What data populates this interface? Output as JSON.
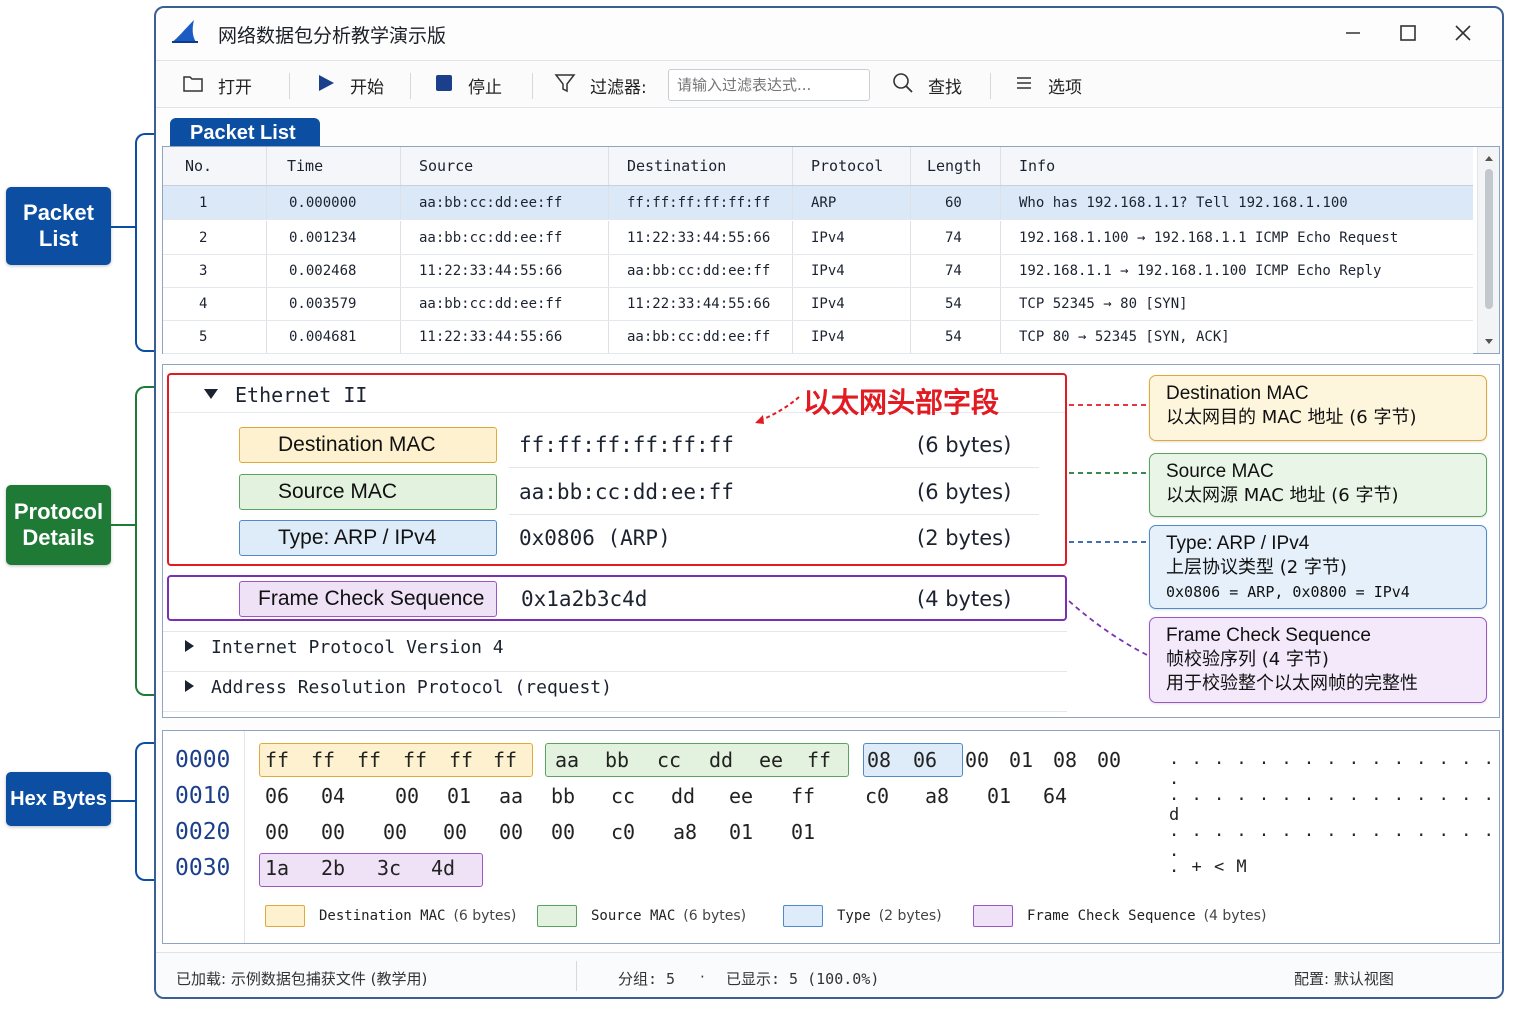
{
  "window": {
    "title": "网络数据包分析教学演示版"
  },
  "callouts": {
    "packet_list": "Packet List",
    "protocol_details": "Protocol Details",
    "hex_bytes": "Hex Bytes"
  },
  "toolbar": {
    "open": "打开",
    "start": "开始",
    "stop": "停止",
    "filter_label": "过滤器:",
    "filter_placeholder": "请输入过滤表达式...",
    "find": "查找",
    "options": "选项"
  },
  "packet_list": {
    "tab": "Packet List",
    "columns": [
      "No.",
      "Time",
      "Source",
      "Destination",
      "Protocol",
      "Length",
      "Info"
    ],
    "rows": [
      [
        "1",
        "0.000000",
        "aa:bb:cc:dd:ee:ff",
        "ff:ff:ff:ff:ff:ff",
        "ARP",
        "60",
        "Who has 192.168.1.1?  Tell  192.168.1.100"
      ],
      [
        "2",
        "0.001234",
        "aa:bb:cc:dd:ee:ff",
        "11:22:33:44:55:66",
        "IPv4",
        "74",
        "192.168.1.100  →  192.168.1.1  ICMP Echo Request"
      ],
      [
        "3",
        "0.002468",
        "11:22:33:44:55:66",
        "aa:bb:cc:dd:ee:ff",
        "IPv4",
        "74",
        "192.168.1.1  →  192.168.1.100  ICMP Echo Reply"
      ],
      [
        "4",
        "0.003579",
        "aa:bb:cc:dd:ee:ff",
        "11:22:33:44:55:66",
        "IPv4",
        "54",
        "TCP 52345  →  80  [SYN]"
      ],
      [
        "5",
        "0.004681",
        "11:22:33:44:55:66",
        "aa:bb:cc:dd:ee:ff",
        "IPv4",
        "54",
        "TCP 80  →  52345  [SYN, ACK]"
      ]
    ],
    "selected_row": 1
  },
  "details": {
    "ethernet_title": "Ethernet II",
    "annotation": "以太网头部字段",
    "fields": [
      {
        "name": "Destination MAC",
        "value": "ff:ff:ff:ff:ff:ff",
        "bytes": "(6 bytes)"
      },
      {
        "name": "Source MAC",
        "value": "aa:bb:cc:dd:ee:ff",
        "bytes": "(6 bytes)"
      },
      {
        "name": "Type: ARP / IPv4",
        "value": "0x0806  (ARP)",
        "bytes": "(2 bytes)"
      }
    ],
    "fcs": {
      "name": "Frame Check Sequence",
      "value": "0x1a2b3c4d",
      "bytes": "(4 bytes)"
    },
    "collapsed": [
      "Internet Protocol Version 4",
      "Address Resolution Protocol (request)"
    ]
  },
  "notes": [
    {
      "title": "Destination MAC",
      "lines": [
        "以太网目的 MAC 地址 (6 字节)"
      ]
    },
    {
      "title": "Source MAC",
      "lines": [
        "以太网源 MAC 地址 (6 字节)"
      ]
    },
    {
      "title": "Type: ARP / IPv4",
      "lines": [
        "上层协议类型 (2 字节)",
        "0x0806 = ARP, 0x0800 = IPv4"
      ]
    },
    {
      "title": "Frame Check Sequence",
      "lines": [
        "帧校验序列 (4 字节)",
        "用于校验整个以太网帧的完整性"
      ]
    }
  ],
  "hex": {
    "rows": [
      {
        "offset": "0000",
        "bytes": [
          "ff",
          "ff",
          "ff",
          "ff",
          "ff",
          "ff",
          "aa",
          "bb",
          "cc",
          "dd",
          "ee",
          "ff",
          "08",
          "06",
          "00",
          "01",
          "08",
          "00"
        ],
        "ascii": ". . . . . . . . . . . . . . . ."
      },
      {
        "offset": "0010",
        "bytes": [
          "06",
          "04",
          "00",
          "01",
          "aa",
          "bb",
          "cc",
          "dd",
          "ee",
          "ff",
          "c0",
          "a8",
          "01",
          "64"
        ],
        "ascii": ". . . . . . . . . . . . . . . d"
      },
      {
        "offset": "0020",
        "bytes": [
          "00",
          "00",
          "00",
          "00",
          "00",
          "00",
          "c0",
          "a8",
          "01",
          "01"
        ],
        "ascii": ". . . . . . . . . . . . . . . ."
      },
      {
        "offset": "0030",
        "bytes": [
          "1a",
          "2b",
          "3c",
          "4d"
        ],
        "ascii": ". + < M"
      }
    ],
    "legend": [
      {
        "label": "Destination MAC",
        "size": "(6 bytes)",
        "color": "#fdf1cf"
      },
      {
        "label": "Source MAC",
        "size": "(6 bytes)",
        "color": "#e3f2df"
      },
      {
        "label": "Type",
        "size": "(2 bytes)",
        "color": "#deecf9"
      },
      {
        "label": "Frame Check Sequence",
        "size": "(4 bytes)",
        "color": "#efe2f7"
      }
    ]
  },
  "status": {
    "loaded": "已加载: 示例数据包捕获文件 (教学用)",
    "packets": "分组: 5",
    "dot": "·",
    "displayed": "已显示: 5 (100.0%)",
    "profile": "配置: 默认视图"
  },
  "colors": {
    "accent": "#0b4ea2",
    "green": "#1f7a36",
    "red": "#e21b23",
    "purple": "#7b2fb3",
    "dest_fill": "#fdf1cf",
    "dest_border": "#e0a93a",
    "src_fill": "#e3f2df",
    "src_border": "#5aa35f",
    "type_fill": "#deecf9",
    "type_border": "#4f8ac9",
    "fcs_fill": "#efe2f7",
    "fcs_border": "#9b57c6"
  }
}
